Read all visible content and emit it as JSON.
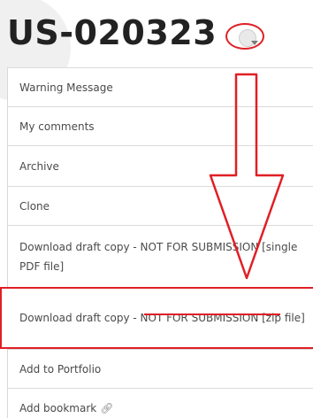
{
  "header": {
    "record_id": "US-020323",
    "dropdown_icon": "chevron-down-icon"
  },
  "menu": {
    "items": [
      {
        "label": "Warning Message"
      },
      {
        "label": "My comments"
      },
      {
        "label": "Archive"
      },
      {
        "label": "Clone"
      },
      {
        "label": "Download draft copy - NOT FOR SUBMISSION [single PDF file]"
      },
      {
        "label": "Download draft copy - NOT FOR SUBMISSION [zip file]"
      },
      {
        "label": "Add to Portfolio"
      },
      {
        "label": "Add bookmark",
        "icon": "link-icon"
      }
    ]
  },
  "annotation": {
    "color": "#e01f26"
  }
}
